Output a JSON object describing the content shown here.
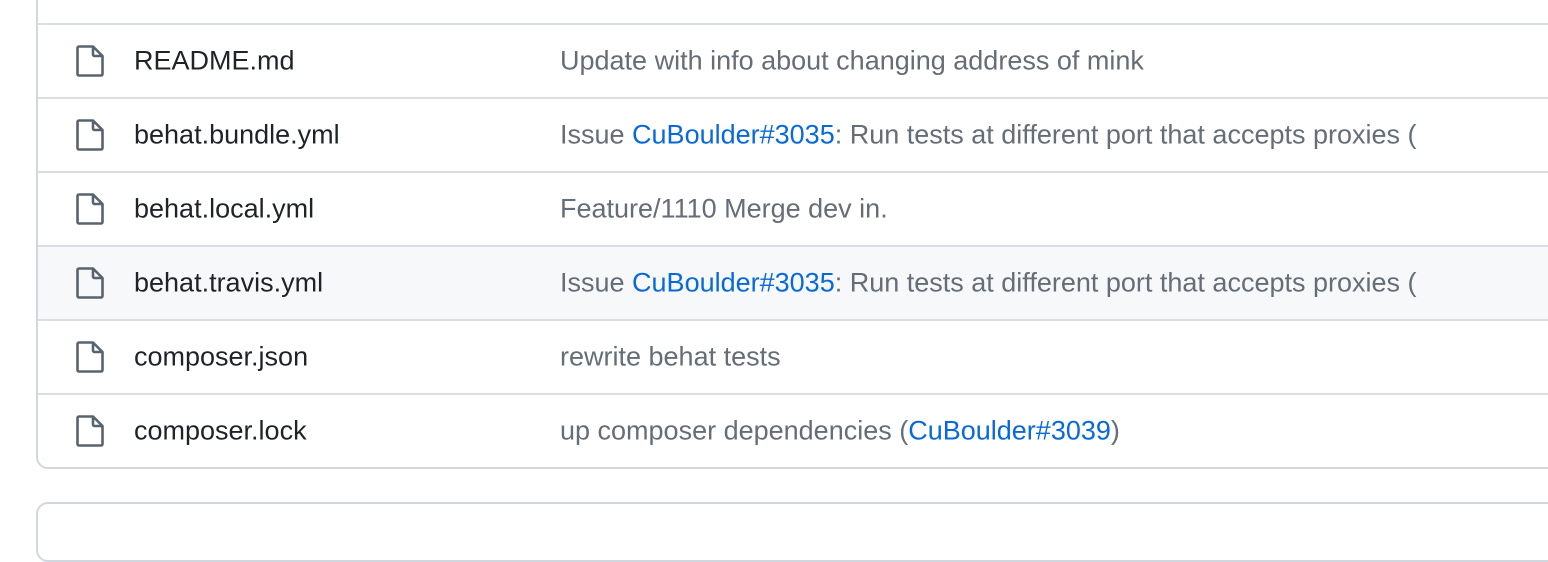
{
  "files": [
    {
      "name": "README.md",
      "icon": "file-icon",
      "message": [
        {
          "text": "Update with info about changing address of mink"
        }
      ]
    },
    {
      "name": "behat.bundle.yml",
      "icon": "file-icon",
      "message": [
        {
          "text": "Issue "
        },
        {
          "text": "CuBoulder#3035",
          "link": true
        },
        {
          "text": ": Run tests at different port that accepts proxies ("
        }
      ]
    },
    {
      "name": "behat.local.yml",
      "icon": "file-icon",
      "message": [
        {
          "text": "Feature/1110 Merge dev in."
        }
      ]
    },
    {
      "name": "behat.travis.yml",
      "icon": "file-icon",
      "hovered": true,
      "message": [
        {
          "text": "Issue "
        },
        {
          "text": "CuBoulder#3035",
          "link": true
        },
        {
          "text": ": Run tests at different port that accepts proxies ("
        }
      ]
    },
    {
      "name": "composer.json",
      "icon": "file-icon",
      "message": [
        {
          "text": "rewrite behat tests"
        }
      ]
    },
    {
      "name": "composer.lock",
      "icon": "file-icon",
      "message": [
        {
          "text": "up composer dependencies ("
        },
        {
          "text": "CuBoulder#3039",
          "link": true
        },
        {
          "text": ")"
        }
      ]
    }
  ],
  "colors": {
    "link": "#0969da",
    "muted_text": "#656d76",
    "primary_text": "#1f2328",
    "border": "#d0d7de",
    "row_hover": "#f6f8fa",
    "folder_icon": "#54aeff"
  }
}
